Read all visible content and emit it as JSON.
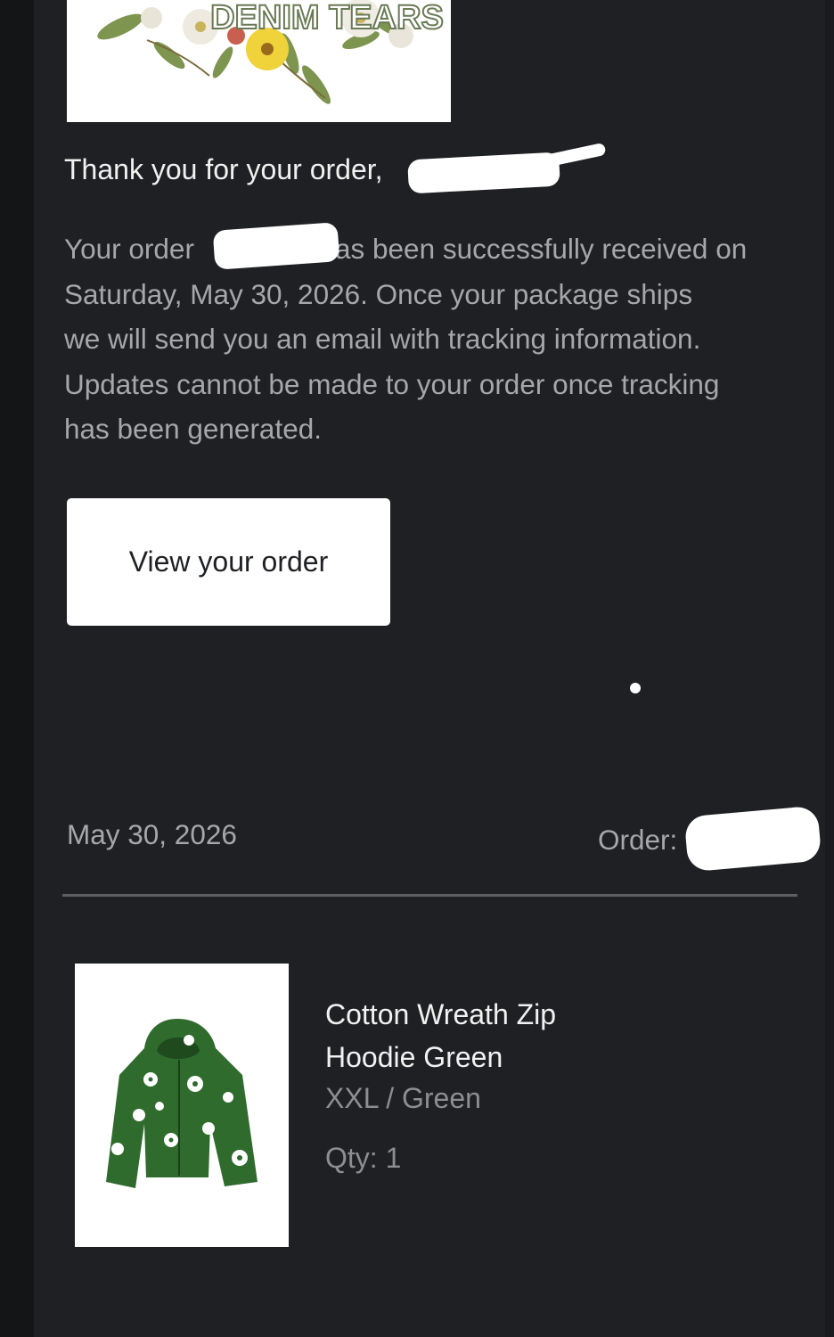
{
  "brand": {
    "logo_text": "DENIM TEARS"
  },
  "greeting": "Thank you for your order,",
  "order_message": {
    "line1_prefix": "Your order",
    "line1_suffix": "has been successfully received on",
    "line2": "Saturday, May 30, 2026. Once your package ships",
    "line3": "we will send you an email with tracking information.",
    "line4": "Updates cannot be made to your order once tracking",
    "line5": "has been generated."
  },
  "view_order_button": "View your order",
  "summary": {
    "date": "May 30, 2026",
    "order_label": "Order:"
  },
  "product": {
    "name": "Cotton Wreath Zip Hoodie Green",
    "variant": "XXL / Green",
    "qty": "Qty: 1",
    "image_icon": "green-hoodie-with-white-flowers"
  },
  "colors": {
    "background": "#1f2023",
    "text_primary": "#f1f1f1",
    "text_secondary": "#a6a7ab",
    "hoodie_green": "#2f6b2c"
  }
}
